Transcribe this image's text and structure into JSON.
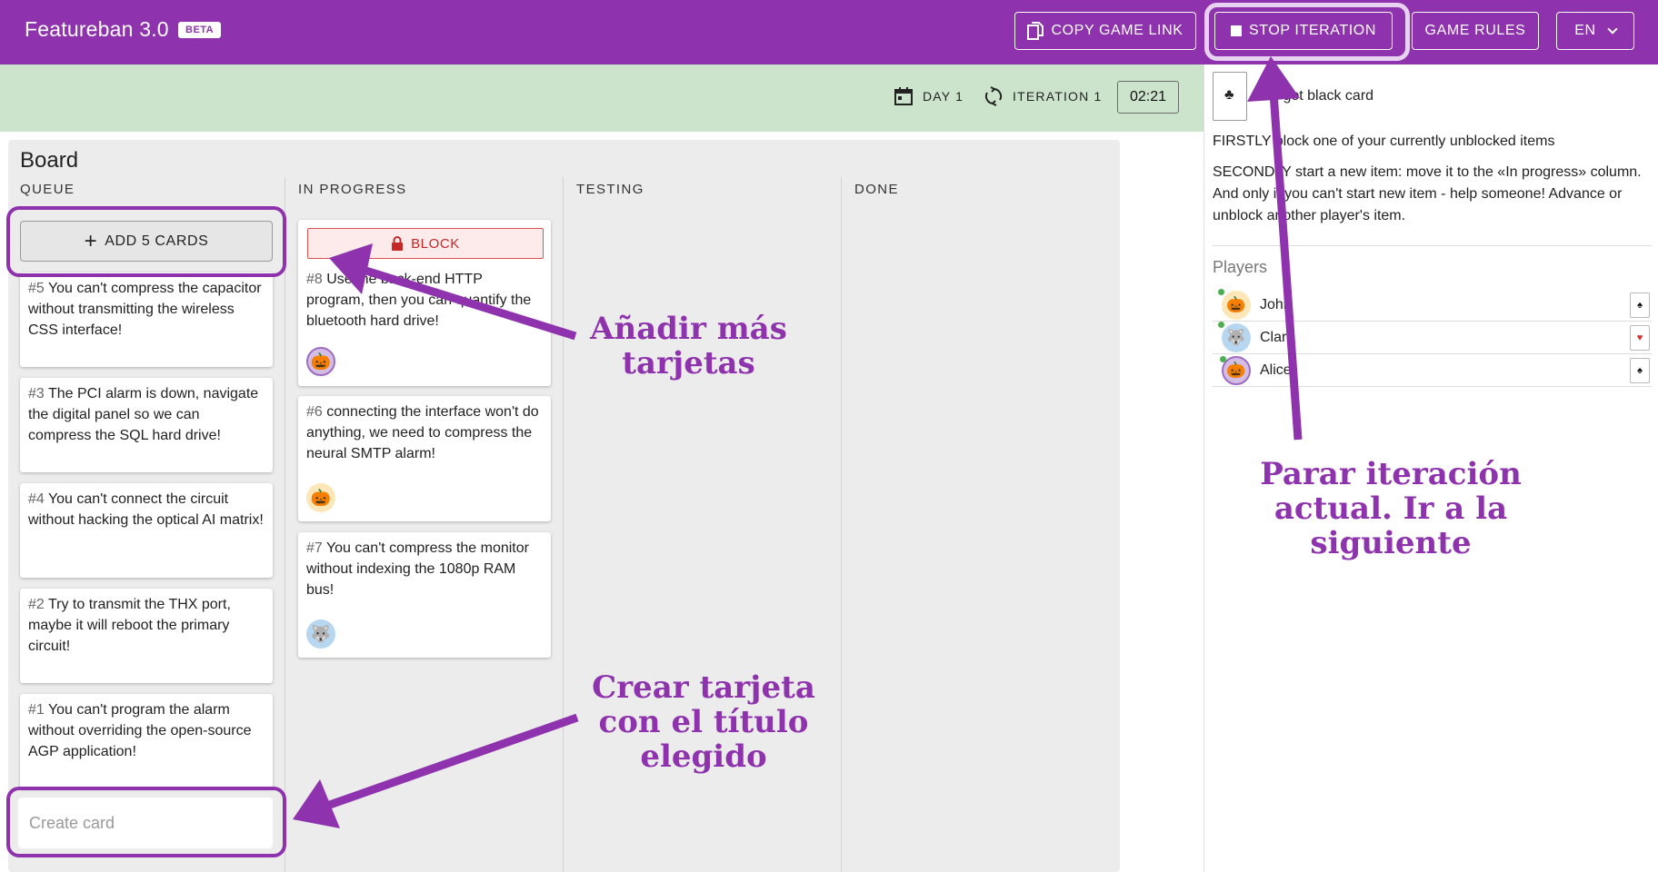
{
  "app": {
    "title": "Featureban 3.0",
    "badge": "BETA"
  },
  "header": {
    "copy_link": "COPY GAME LINK",
    "stop_iteration": "STOP ITERATION",
    "game_rules": "GAME RULES",
    "language": "EN"
  },
  "status": {
    "day": "DAY 1",
    "iteration": "ITERATION 1",
    "timer": "02:21"
  },
  "board": {
    "title": "Board",
    "columns": [
      "QUEUE",
      "IN PROGRESS",
      "TESTING",
      "DONE"
    ],
    "add_cards": "ADD 5 CARDS",
    "block_label": "BLOCK",
    "create_placeholder": "Create card",
    "queue": [
      {
        "num": "#5",
        "text": "You can't compress the capacitor without transmitting the wireless CSS interface!"
      },
      {
        "num": "#3",
        "text": "The PCI alarm is down, navigate the digital panel so we can compress the SQL hard drive!"
      },
      {
        "num": "#4",
        "text": "You can't connect the circuit without hacking the optical AI matrix!"
      },
      {
        "num": "#2",
        "text": "Try to transmit the THX port, maybe it will reboot the primary circuit!"
      },
      {
        "num": "#1",
        "text": "You can't program the alarm without overriding the open-source AGP application!"
      }
    ],
    "in_progress": [
      {
        "num": "#8",
        "text": "Use the back-end HTTP program, then you can quantify the bluetooth hard drive!",
        "avatar": "pumpkin-icon"
      },
      {
        "num": "#6",
        "text": "connecting the interface won't do anything, we need to compress the neural SMTP alarm!",
        "avatar": "pumpkin-icon"
      },
      {
        "num": "#7",
        "text": "You can't compress the monitor without indexing the 1080p RAM bus!",
        "avatar": "wolf-icon"
      }
    ]
  },
  "panel": {
    "got_card": "You got black card",
    "firstly": "FIRSTLY block one of your currently unblocked items",
    "secondly": "SECONDLY start a new item: move it to the «In progress» column. And only if you can't start new item - help someone! Advance or unblock another player's item.",
    "players_label": "Players",
    "players": [
      {
        "name": "John",
        "avatar": "pumpkin-icon",
        "card": "♠",
        "card_color": "#111111"
      },
      {
        "name": "Clara",
        "avatar": "wolf-icon",
        "card": "♥",
        "card_color": "#d32f2f"
      },
      {
        "name": "Alice",
        "avatar": "pumpkin-icon",
        "card": "♠",
        "card_color": "#111111"
      }
    ]
  },
  "annotations": {
    "add_more": "Añadir más tarjetas",
    "stop": "Parar iteración actual. Ir a la siguiente",
    "create": "Crear tarjeta con el título elegido"
  },
  "colors": {
    "brand": "#8e33ad",
    "status_bg": "#cde4cc",
    "block": "#c62828"
  }
}
